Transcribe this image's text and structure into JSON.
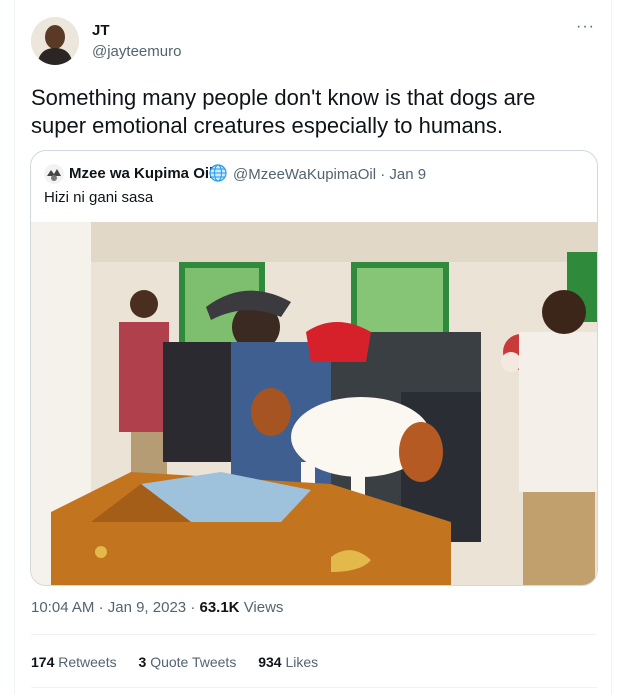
{
  "tweet": {
    "author_name": "JT",
    "author_handle": "@jayteemuro",
    "more_label": "···",
    "text": "Something many people don't know is that dogs are super emotional creatures especially to humans."
  },
  "quoted": {
    "author_name": "Mzee wa Kupima Oil",
    "author_handle": "@MzeeWaKupimaOil",
    "separator": "·",
    "date": "Jan 9",
    "text": "Hizi ni gani sasa"
  },
  "timestamp": {
    "time": "10:04 AM",
    "separator1": "·",
    "date": "Jan 9, 2023",
    "separator2": "·",
    "views_count": "63.1K",
    "views_label": "Views"
  },
  "stats": [
    {
      "count": "174",
      "label": "Retweets"
    },
    {
      "count": "3",
      "label": "Quote Tweets"
    },
    {
      "count": "934",
      "label": "Likes"
    }
  ],
  "colors": {
    "text_primary": "#0f1419",
    "text_secondary": "#536471",
    "border": "#cfd9de",
    "divider": "#eff3f4"
  },
  "icons": {
    "more": "more-horizontal-icon",
    "globe": "globe-icon"
  }
}
